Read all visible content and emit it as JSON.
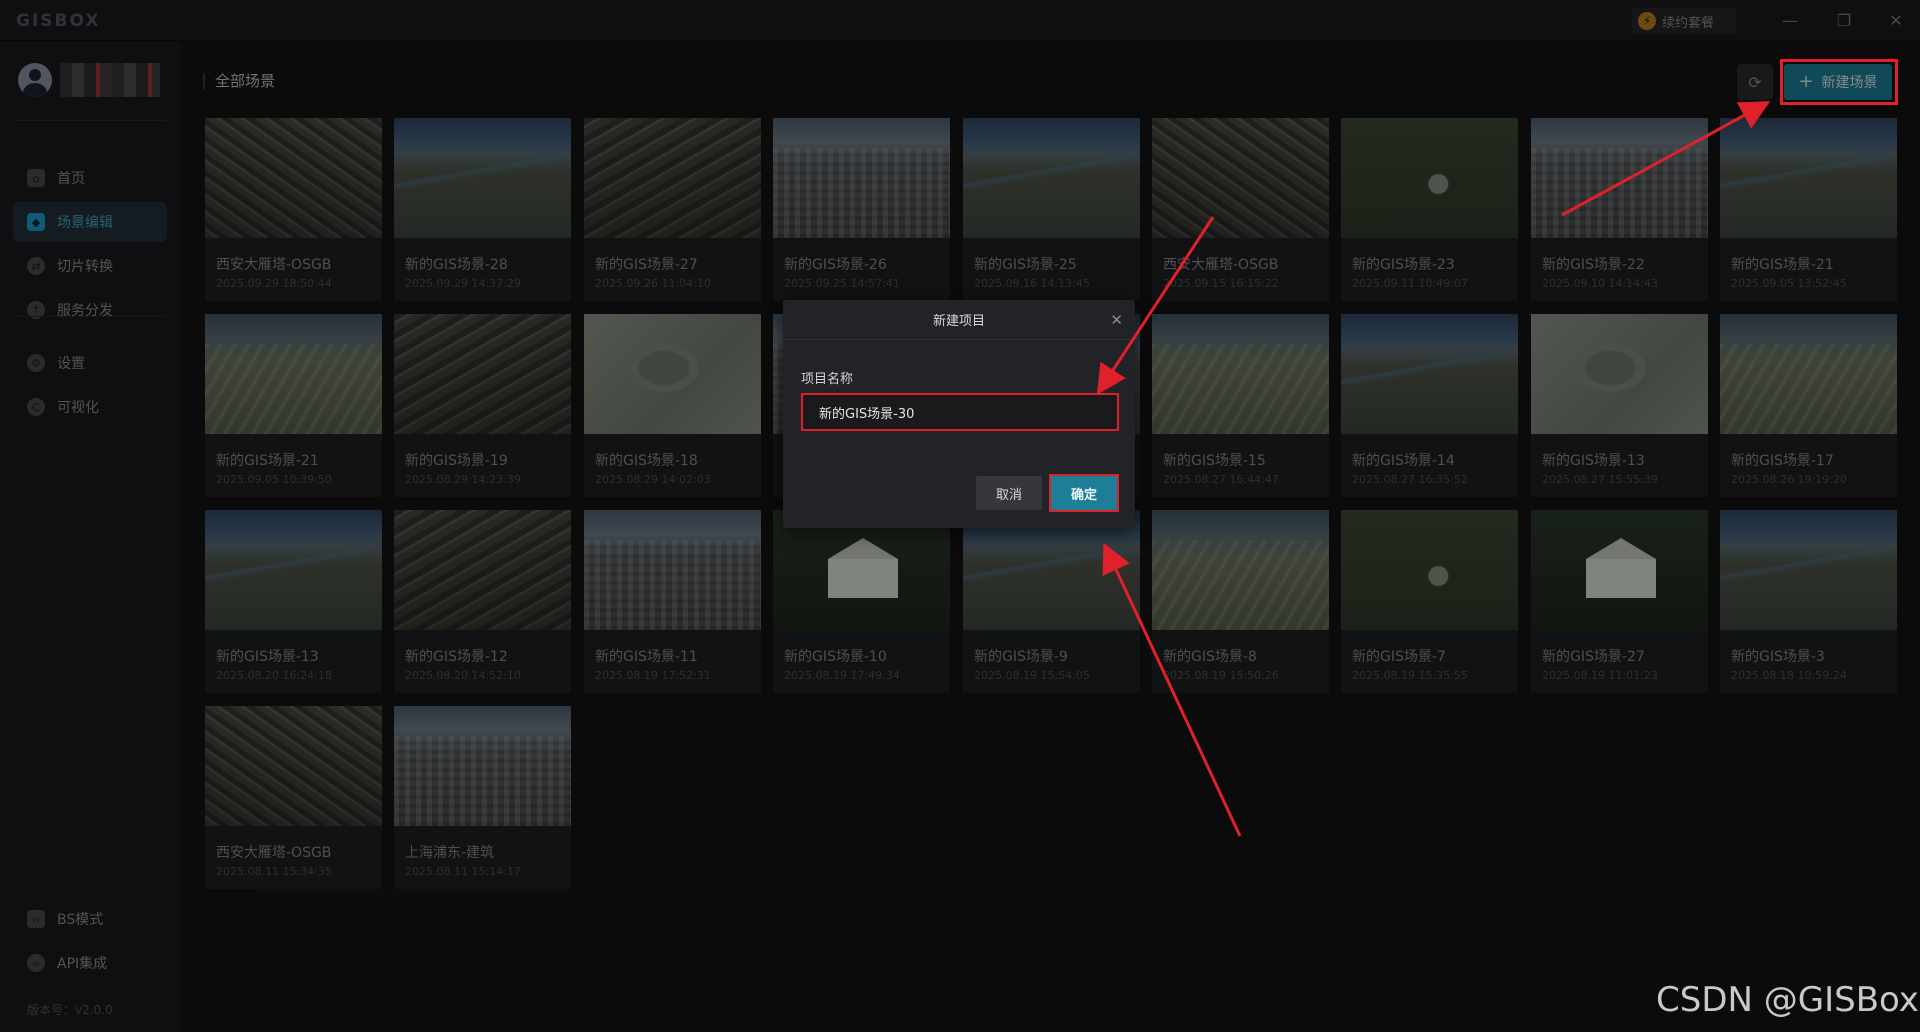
{
  "titlebar": {
    "logo": "GISBOX",
    "renew_label": "续约套餐",
    "minimize": "—",
    "restore": "❐",
    "close": "✕"
  },
  "sidebar": {
    "nav_top": [
      {
        "label": "首页",
        "icon": "home-icon",
        "active": false
      },
      {
        "label": "场景编辑",
        "icon": "cube-icon",
        "active": true
      },
      {
        "label": "切片转换",
        "icon": "convert-icon",
        "active": false
      },
      {
        "label": "服务分发",
        "icon": "upload-icon",
        "active": false
      }
    ],
    "nav_mid": [
      {
        "label": "设置",
        "icon": "settings-icon"
      },
      {
        "label": "可视化",
        "icon": "visualize-icon"
      }
    ],
    "nav_bottom": [
      {
        "label": "BS模式",
        "icon": "code-icon"
      },
      {
        "label": "API集成",
        "icon": "link-icon"
      }
    ],
    "version": "版本号：v2.0.0"
  },
  "main": {
    "title": "全部场景",
    "new_button": "新建场景",
    "scenes": [
      {
        "name": "西安大雁塔-OSGB",
        "date": "2025.09.29 18:50:44",
        "thumb": "city"
      },
      {
        "name": "新的GIS场景-28",
        "date": "2025.09.29 14:37:29",
        "thumb": "river"
      },
      {
        "name": "新的GIS场景-27",
        "date": "2025.09.26 11:04:10",
        "thumb": "rail"
      },
      {
        "name": "新的GIS场景-26",
        "date": "2025.09.25 14:57:41",
        "thumb": "dense"
      },
      {
        "name": "新的GIS场景-25",
        "date": "2025.09.16 14:13:45",
        "thumb": "river"
      },
      {
        "name": "西安大雁塔-OSGB",
        "date": "2025.09.15 16:15:22",
        "thumb": "city"
      },
      {
        "name": "新的GIS场景-23",
        "date": "2025.09.11 10:49:07",
        "thumb": "green"
      },
      {
        "name": "新的GIS场景-22",
        "date": "2025.09.10 14:14:43",
        "thumb": "dense"
      },
      {
        "name": "新的GIS场景-21",
        "date": "2025.09.05 13:52:45",
        "thumb": "river"
      },
      {
        "name": "新的GIS场景-21",
        "date": "2025.09.05 10:39:50",
        "thumb": "valley"
      },
      {
        "name": "新的GIS场景-19",
        "date": "2025.08.29 14:23:39",
        "thumb": "rail"
      },
      {
        "name": "新的GIS场景-18",
        "date": "2025.08.29 14:02:03",
        "thumb": "sat"
      },
      {
        "name": "",
        "date": "",
        "thumb": "dense"
      },
      {
        "name": "",
        "date": "",
        "thumb": "river"
      },
      {
        "name": "新的GIS场景-15",
        "date": "2025.08.27 16:44:47",
        "thumb": "valley"
      },
      {
        "name": "新的GIS场景-14",
        "date": "2025.08.27 16:35:52",
        "thumb": "river"
      },
      {
        "name": "新的GIS场景-13",
        "date": "2025.08.27 15:55:39",
        "thumb": "sat"
      },
      {
        "name": "新的GIS场景-17",
        "date": "2025.08.26 19:19:20",
        "thumb": "valley"
      },
      {
        "name": "新的GIS场景-13",
        "date": "2025.08.20 16:24:18",
        "thumb": "river"
      },
      {
        "name": "新的GIS场景-12",
        "date": "2025.08.20 14:52:10",
        "thumb": "rail"
      },
      {
        "name": "新的GIS场景-11",
        "date": "2025.08.19 17:52:31",
        "thumb": "dense"
      },
      {
        "name": "新的GIS场景-10",
        "date": "2025.08.19 17:49:34",
        "thumb": "house"
      },
      {
        "name": "新的GIS场景-9",
        "date": "2025.08.19 15:54:05",
        "thumb": "river"
      },
      {
        "name": "新的GIS场景-8",
        "date": "2025.08.19 15:50:26",
        "thumb": "valley"
      },
      {
        "name": "新的GIS场景-7",
        "date": "2025.08.19 15:35:55",
        "thumb": "green"
      },
      {
        "name": "新的GIS场景-27",
        "date": "2025.08.19 11:01:23",
        "thumb": "house"
      },
      {
        "name": "新的GIS场景-3",
        "date": "2025.08.18 10:59:24",
        "thumb": "river"
      },
      {
        "name": "西安大雁塔-OSGB",
        "date": "2025.08.11 15:34:35",
        "thumb": "city"
      },
      {
        "name": "上海浦东-建筑",
        "date": "2025.08.11 15:14:17",
        "thumb": "dense"
      }
    ]
  },
  "dialog": {
    "title": "新建项目",
    "field_label": "项目名称",
    "field_value": "新的GIS场景-30",
    "cancel": "取消",
    "confirm": "确定"
  },
  "watermark": "CSDN @GISBox",
  "colors": {
    "accent": "#1c7e97",
    "highlight": "#e0202a",
    "active_nav": "#3fa9c9"
  }
}
